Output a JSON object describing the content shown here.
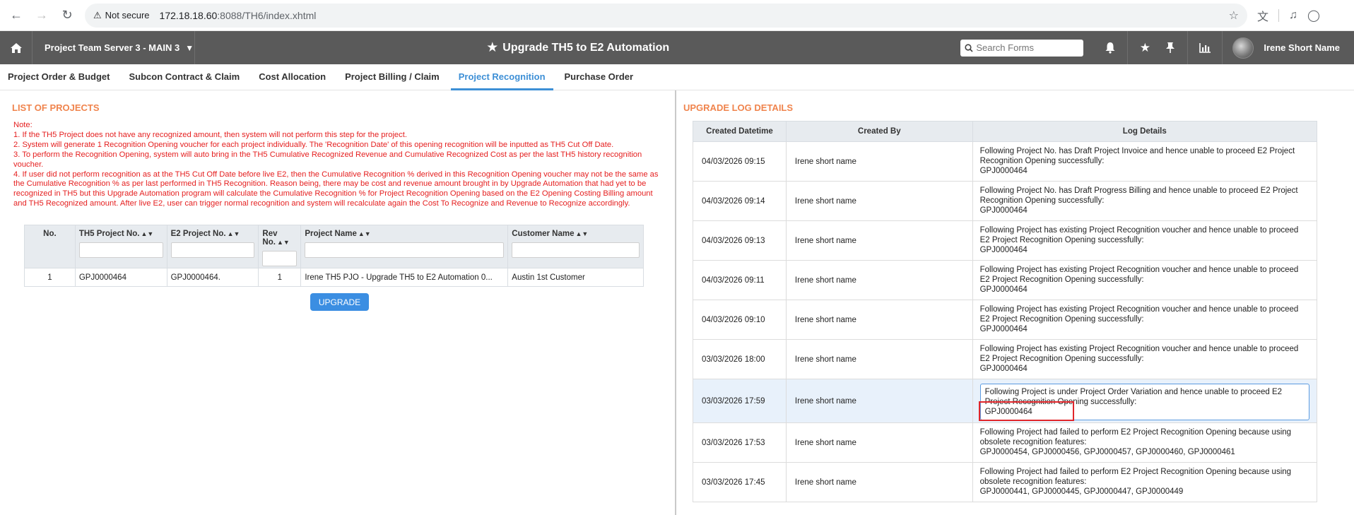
{
  "browser": {
    "not_secure": "Not secure",
    "url_host": "172.18.18.60",
    "url_path": ":8088/TH6/index.xhtml"
  },
  "header": {
    "server": "Project Team Server 3 - MAIN 3",
    "title": "Upgrade TH5 to E2 Automation",
    "search_placeholder": "Search Forms",
    "user": "Irene Short Name"
  },
  "tabs": [
    {
      "label": "Project Order & Budget"
    },
    {
      "label": "Subcon Contract & Claim"
    },
    {
      "label": "Cost Allocation"
    },
    {
      "label": "Project Billing / Claim"
    },
    {
      "label": "Project Recognition",
      "active": true
    },
    {
      "label": "Purchase Order"
    }
  ],
  "left": {
    "title": "LIST OF PROJECTS",
    "note_label": "Note:",
    "notes": [
      "1. If the TH5 Project does not have any recognized amount, then system will not perform this step for the project.",
      "2. System will generate 1 Recognition Opening voucher for each project individually. The 'Recognition Date' of this opening recognition will be inputted as TH5 Cut Off Date.",
      "3. To perform the Recognition Opening, system will auto bring in the TH5 Cumulative Recognized Revenue and Cumulative Recognized Cost as per the last TH5 history recognition voucher.",
      "4. If user did not perform recognition as at the TH5 Cut Off Date before live E2, then the Cumulative Recognition % derived in this Recognition Opening voucher may not be the same as the Cumulative Recognition % as per last performed in TH5 Recognition. Reason being, there may be cost and revenue amount brought in by Upgrade Automation that had yet to be recognized in TH5 but this Upgrade Automation program will calculate the Cumulative Recognition % for Project Recognition Opening based on the E2 Opening Costing   Billing amount and TH5 Recognized amount. After live E2, user can trigger normal recognition and system will recalculate again the Cost To Recognize and Revenue to Recognize accordingly."
    ],
    "columns": [
      "No.",
      "TH5 Project No.",
      "E2 Project No.",
      "Rev No.",
      "Project Name",
      "Customer Name"
    ],
    "rows": [
      {
        "no": "1",
        "th5": "GPJ0000464",
        "e2": "GPJ0000464.",
        "rev": "1",
        "name": "Irene TH5 PJO - Upgrade TH5 to E2 Automation 0...",
        "customer": "Austin 1st Customer"
      }
    ],
    "upgrade_label": "UPGRADE"
  },
  "right": {
    "title": "UPGRADE LOG DETAILS",
    "columns": [
      "Created Datetime",
      "Created By",
      "Log Details"
    ],
    "rows": [
      {
        "datetime": "04/03/2026 09:15",
        "by": "Irene short name",
        "details": "Following Project No. has Draft Project Invoice and hence unable to proceed E2 Project Recognition Opening successfully:",
        "tail": "GPJ0000464"
      },
      {
        "datetime": "04/03/2026 09:14",
        "by": "Irene short name",
        "details": "Following Project No. has Draft Progress Billing and hence unable to proceed E2 Project Recognition Opening successfully:",
        "tail": "GPJ0000464"
      },
      {
        "datetime": "04/03/2026 09:13",
        "by": "Irene short name",
        "details": "Following Project has existing Project Recognition voucher and hence unable to proceed E2 Project Recognition Opening successfully:",
        "tail": "GPJ0000464"
      },
      {
        "datetime": "04/03/2026 09:11",
        "by": "Irene short name",
        "details": "Following Project has existing Project Recognition voucher and hence unable to proceed E2 Project Recognition Opening successfully:",
        "tail": "GPJ0000464"
      },
      {
        "datetime": "04/03/2026 09:10",
        "by": "Irene short name",
        "details": "Following Project has existing Project Recognition voucher and hence unable to proceed E2 Project Recognition Opening successfully:",
        "tail": "GPJ0000464"
      },
      {
        "datetime": "03/03/2026 18:00",
        "by": "Irene short name",
        "details": "Following Project has existing Project Recognition voucher and hence unable to proceed E2 Project Recognition Opening successfully:",
        "tail": "GPJ0000464"
      },
      {
        "datetime": "03/03/2026 17:59",
        "by": "Irene short name",
        "details": "Following Project is under Project Order Variation and hence unable to proceed E2 Project Recognition Opening successfully:",
        "tail": "GPJ0000464",
        "selected": true
      },
      {
        "datetime": "03/03/2026 17:53",
        "by": "Irene short name",
        "details": "Following Project had failed to perform E2 Project Recognition Opening because using obsolete recognition features:",
        "tail": "GPJ0000454, GPJ0000456, GPJ0000457, GPJ0000460, GPJ0000461"
      },
      {
        "datetime": "03/03/2026 17:45",
        "by": "Irene short name",
        "details": "Following Project had failed to perform E2 Project Recognition Opening because using obsolete recognition features:",
        "tail": "GPJ0000441, GPJ0000445, GPJ0000447, GPJ0000449"
      }
    ]
  },
  "colors": {
    "header_bg": "#5a5a5a",
    "accent": "#3d8fd6",
    "title_orange": "#f0844d",
    "note_red": "#e52020"
  }
}
